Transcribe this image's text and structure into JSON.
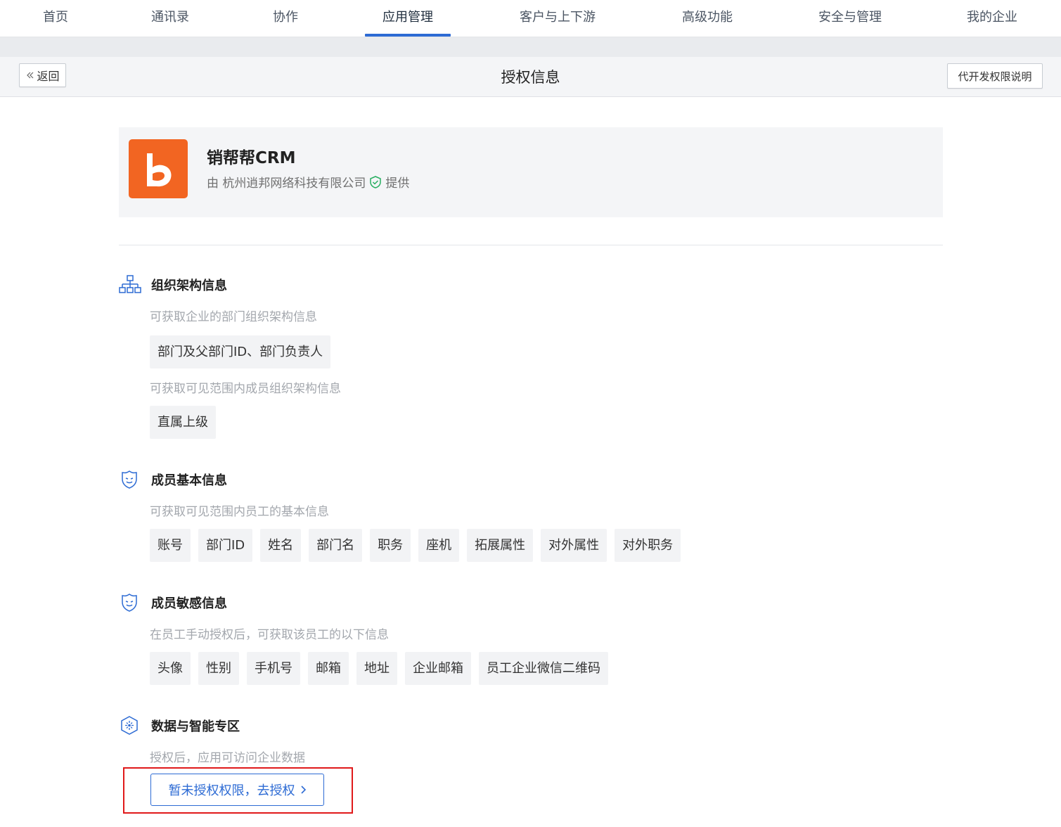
{
  "nav": {
    "items": [
      {
        "label": "首页"
      },
      {
        "label": "通讯录"
      },
      {
        "label": "协作"
      },
      {
        "label": "应用管理"
      },
      {
        "label": "客户与上下游"
      },
      {
        "label": "高级功能"
      },
      {
        "label": "安全与管理"
      },
      {
        "label": "我的企业"
      }
    ],
    "active": "应用管理"
  },
  "header": {
    "back_label": "返回",
    "title": "授权信息",
    "help_label": "代开发权限说明"
  },
  "app": {
    "name": "销帮帮CRM",
    "provider_prefix": "由 杭州逍邦网络科技有限公司",
    "provider_suffix": "提供",
    "logo_color": "#f26522",
    "verified_icon": "shield-check-icon"
  },
  "sections": {
    "org": {
      "title": "组织架构信息",
      "icon": "org-chart-icon",
      "desc1": "可获取企业的部门组织架构信息",
      "tags1": [
        "部门及父部门ID、部门负责人"
      ],
      "desc2": "可获取可见范围内成员组织架构信息",
      "tags2": [
        "直属上级"
      ]
    },
    "basic": {
      "title": "成员基本信息",
      "icon": "shield-face-icon",
      "desc": "可获取可见范围内员工的基本信息",
      "tags": [
        "账号",
        "部门ID",
        "姓名",
        "部门名",
        "职务",
        "座机",
        "拓展属性",
        "对外属性",
        "对外职务"
      ]
    },
    "sensitive": {
      "title": "成员敏感信息",
      "icon": "shield-face-icon",
      "desc": "在员工手动授权后，可获取该员工的以下信息",
      "tags": [
        "头像",
        "性别",
        "手机号",
        "邮箱",
        "地址",
        "企业邮箱",
        "员工企业微信二维码"
      ]
    },
    "data": {
      "title": "数据与智能专区",
      "icon": "sparkle-hexagon-icon",
      "desc": "授权后，应用可访问企业数据",
      "button_label": "暂未授权权限，去授权"
    }
  },
  "colors": {
    "accent": "#2d6bd4",
    "highlight_border": "#e0191a"
  }
}
